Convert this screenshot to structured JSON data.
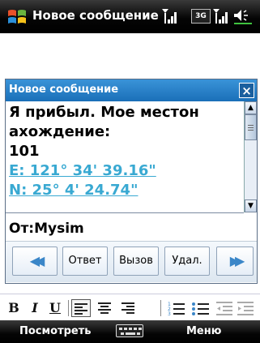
{
  "status_bar": {
    "title": "Новое сообщение",
    "network_type": "3G",
    "icons": [
      "windows-start-icon",
      "signal-strength-icon",
      "3g-icon",
      "signal-strength-icon",
      "volume-icon"
    ]
  },
  "dialog": {
    "title": "Новое сообщение",
    "close_label": "×",
    "message_lines": [
      "Я прибыл. Мое местон",
      "ахождение:",
      "101"
    ],
    "longitude_link": "E: 121° 34' 39.16\"",
    "latitude_link": "N: 25° 4' 24.74\"",
    "from_line": "От:Mysim",
    "buttons": {
      "reply": "Ответ",
      "call": "Вызов",
      "delete": "Удал."
    }
  },
  "toolbar": {
    "bold": "B",
    "italic": "I",
    "underline": "U"
  },
  "softkeys": {
    "left": "Посмотреть",
    "right": "Меню"
  },
  "colors": {
    "dialog_title_bg": "#2a82c9",
    "link": "#39a9d2",
    "bar_bg": "#000000"
  }
}
